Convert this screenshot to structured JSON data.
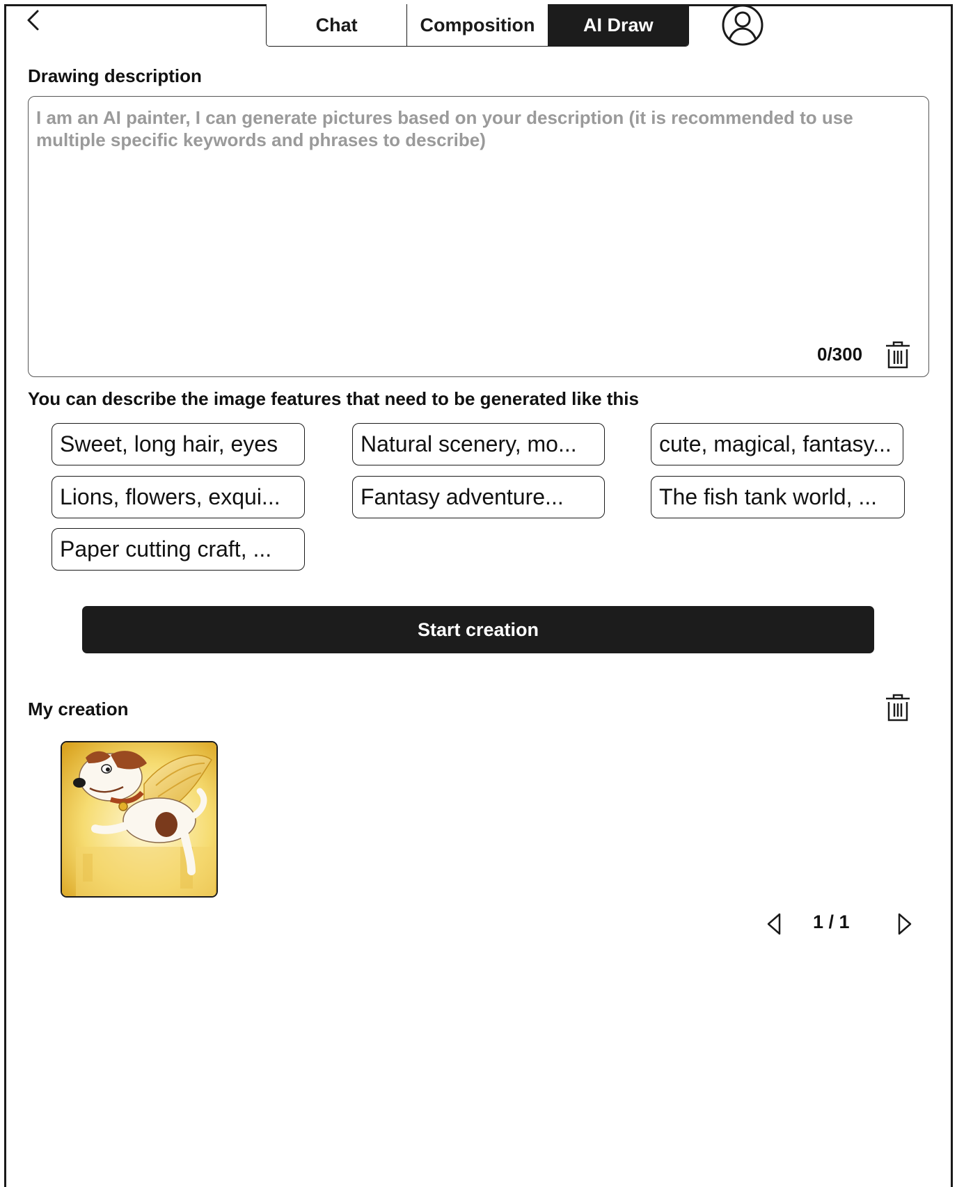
{
  "header": {
    "back_icon": "chevron-left-icon",
    "tabs": [
      {
        "label": "Chat",
        "active": false
      },
      {
        "label": "Composition",
        "active": false
      },
      {
        "label": "AI Draw",
        "active": true
      }
    ],
    "avatar_icon": "user-circle-icon"
  },
  "description": {
    "label": "Drawing description",
    "value": "",
    "placeholder": "I am an AI painter, I can generate pictures based on your description (it is recommended to use multiple specific keywords and phrases to describe)",
    "counter": "0/300",
    "clear_icon": "trash-icon"
  },
  "suggestions": {
    "label": "You can describe the image features that need to be generated like this",
    "chips": [
      "Sweet, long hair, eyes",
      "Natural scenery, mo...",
      "cute, magical, fantasy...",
      "Lions, flowers, exqui...",
      "Fantasy adventure...",
      "The fish tank world, ...",
      "Paper cutting craft, ..."
    ]
  },
  "start_button": {
    "label": "Start creation"
  },
  "my_creation": {
    "label": "My creation",
    "delete_icon": "trash-icon",
    "items": [
      {
        "thumbnail": "winged-dog-illustration"
      }
    ],
    "pagination": {
      "text": "1 / 1"
    }
  },
  "colors": {
    "dark": "#1c1c1c",
    "placeholder": "#9a9a9a",
    "background": "#ffffff"
  }
}
